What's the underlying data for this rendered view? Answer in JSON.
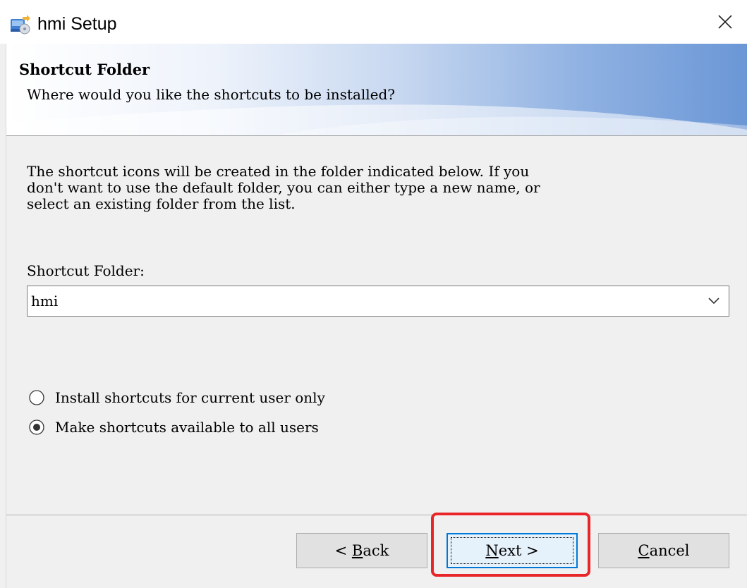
{
  "window": {
    "title": "hmi Setup",
    "app_icon": "installer-icon",
    "close_icon": "close-icon"
  },
  "banner": {
    "heading": "Shortcut Folder",
    "subheading": "Where would you like the shortcuts to be installed?"
  },
  "body": {
    "description": "The shortcut icons will be created in the folder indicated below. If you\ndon't want to use the default folder, you can either type a new name, or\nselect an existing folder from the list.",
    "folder_label": "Shortcut Folder:",
    "folder_value": "hmi",
    "dropdown_icon": "chevron-down-icon"
  },
  "options": {
    "current_user_label": "Install shortcuts for current user only",
    "all_users_label": "Make shortcuts available to all users",
    "selected": "all_users"
  },
  "buttons": {
    "back_prefix": "< ",
    "back_mnemonic": "B",
    "back_rest": "ack",
    "next_mnemonic": "N",
    "next_rest": "ext",
    "next_suffix": " >",
    "cancel_mnemonic": "C",
    "cancel_rest": "ancel",
    "default_button": "next"
  },
  "annotation": {
    "highlight_target": "next-button",
    "highlight_color": "#e8262a"
  }
}
